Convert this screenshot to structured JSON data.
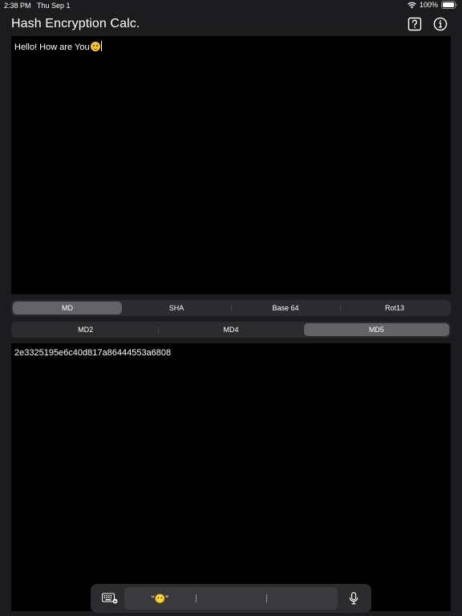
{
  "status_bar": {
    "time": "2:38 PM",
    "date": "Thu Sep 1",
    "battery": "100%",
    "icons": [
      "wifi-icon",
      "battery-icon"
    ]
  },
  "header": {
    "title": "Hash Encryption Calc.",
    "actions": [
      "help-icon",
      "info-icon"
    ]
  },
  "input": {
    "text": "Hello! How are You",
    "trailing_emoji_icon": "shushing-face-emoji-icon"
  },
  "hash_family": {
    "options": [
      "MD",
      "SHA",
      "Base 64",
      "Rot13"
    ],
    "selected": "MD"
  },
  "md_variant": {
    "options": [
      "MD2",
      "MD4",
      "MD5"
    ],
    "selected": "MD5"
  },
  "output": {
    "text": "2e3325195e6c40d817a86444553a6808"
  },
  "keyboard_bar": {
    "predictions": [
      "“😶”",
      "",
      ""
    ],
    "icons": [
      "keyboard-icon",
      "microphone-icon"
    ]
  },
  "colors": {
    "background": "#1c1c1e",
    "text_area": "#000000",
    "segment_bg": "#2c2c2e",
    "segment_selected": "#636366"
  }
}
